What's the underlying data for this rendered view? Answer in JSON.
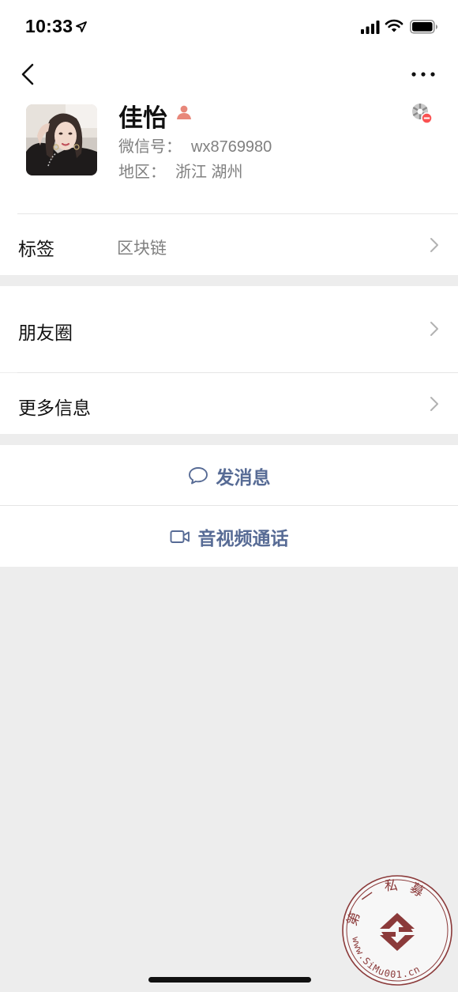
{
  "status": {
    "time": "10:33"
  },
  "profile": {
    "name": "佳怡",
    "wechat_id_label": "微信号：",
    "wechat_id": "wx8769980",
    "region_label": "地区：",
    "region": "浙江 湖州"
  },
  "rows": {
    "tags": {
      "label": "标签",
      "value": "区块链"
    },
    "moments": {
      "label": "朋友圈"
    },
    "more_info": {
      "label": "更多信息"
    }
  },
  "actions": {
    "send_message": "发消息",
    "video_call": "音视频通话"
  },
  "watermark": {
    "top_text": "第一私募",
    "bottom_text": "www.SiMu001.cn"
  },
  "colors": {
    "link_blue": "#576b95",
    "background": "#ededed",
    "seal_red": "#8b3a3a"
  }
}
